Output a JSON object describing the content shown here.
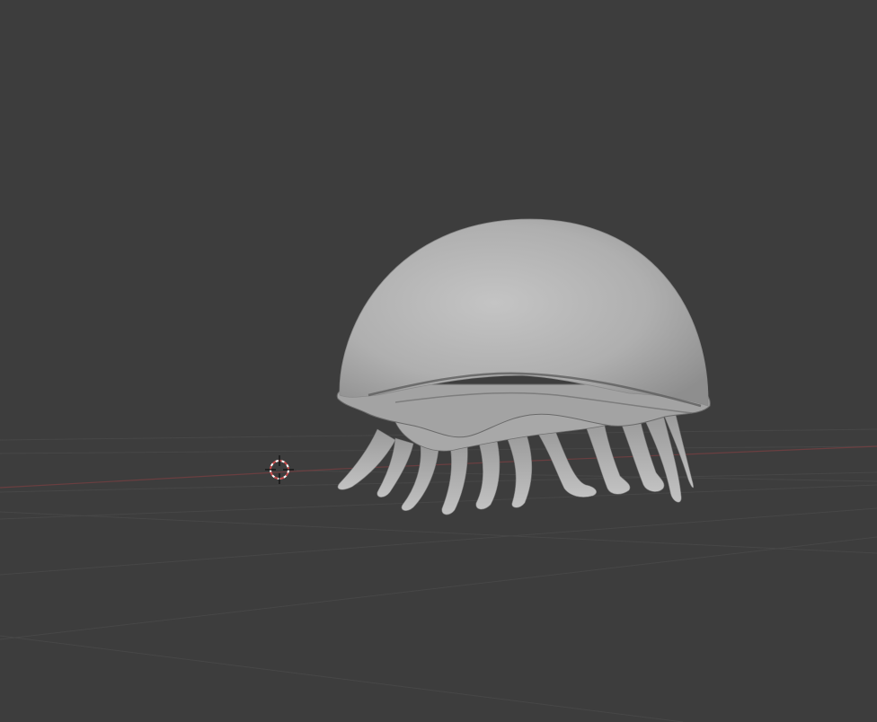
{
  "viewport": {
    "background": "#3d3d3d",
    "grid_color": "#474747",
    "x_axis_color": "#7a3f42",
    "cursor_color": "#c84b4b",
    "mesh_color": "#b9b9b9",
    "mesh_shadow_color": "#6e6e6e"
  },
  "scene": {
    "object": "jellyfish-sculpt-mesh",
    "cursor_icon": "3d-cursor-icon"
  }
}
